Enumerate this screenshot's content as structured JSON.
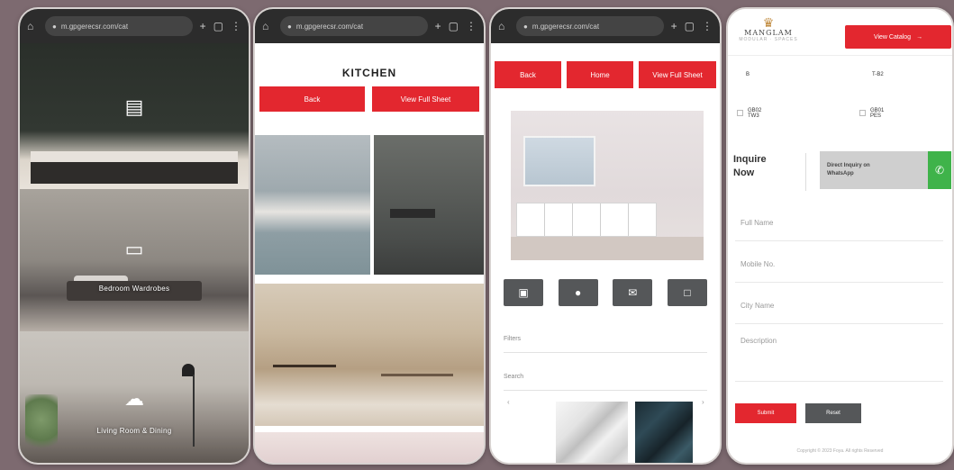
{
  "browser": {
    "url": "m.gpgerecsr.com/cat",
    "lock_icon": "lock-icon",
    "tabs_icon": "tabs-icon",
    "menu_icon": "kebab-menu-icon"
  },
  "phone1": {
    "section2_caption": "Bedroom Wardrobes",
    "section3_caption": "Living Room & Dining"
  },
  "phone2": {
    "title": "KITCHEN",
    "buttons": [
      "Back",
      "View Full Sheet"
    ]
  },
  "phone3": {
    "buttons": [
      "Back",
      "Home",
      "View Full Sheet"
    ],
    "icons": [
      "image-icon",
      "circle-icon",
      "envelope-icon",
      "square-icon"
    ],
    "fields": [
      "Filters",
      "Search"
    ]
  },
  "phone4": {
    "logo_name": "MANGLAM",
    "logo_sub": "MODULAR · SPACES",
    "catalog_button": "View Catalog",
    "rows": [
      {
        "left": "B",
        "right": "T-B2"
      },
      {
        "left": "GB02\nTW3",
        "right": "GB01\nPES"
      }
    ],
    "inquire_label": "Inquire\nNow",
    "whatsapp_text": "Direct Inquiry on\nWhatsApp",
    "inputs": [
      "Full Name",
      "Mobile No.",
      "City Name",
      "Description"
    ],
    "submit": "Submit",
    "reset": "Reset",
    "copyright": "Copyright © 2023 Foya. All rights Reserved"
  },
  "colors": {
    "accent_red": "#e3272f",
    "whatsapp_green": "#3fb34a",
    "dark_button": "#555759",
    "background": "#7d6a70"
  }
}
